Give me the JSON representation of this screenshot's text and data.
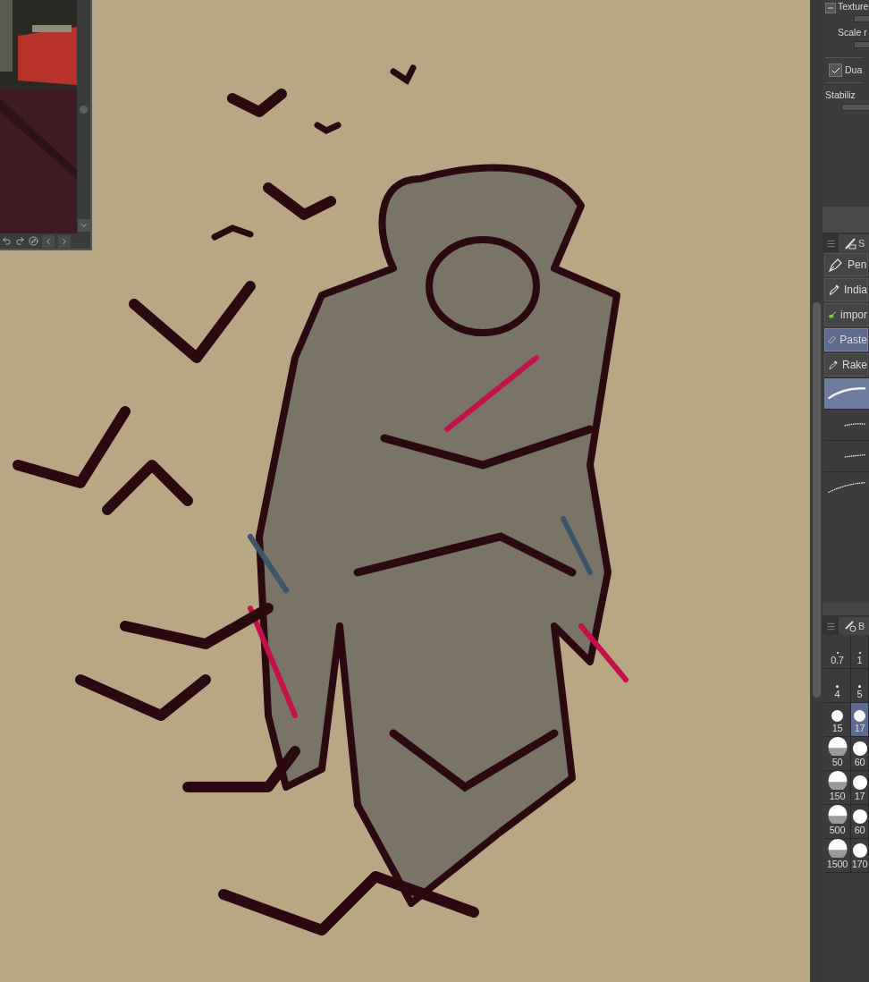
{
  "tool_property": {
    "group": {
      "expanded": true,
      "items": [
        {
          "label": "Texture"
        },
        {
          "label": "Scale r"
        }
      ]
    },
    "checkbox": {
      "label": "Dua",
      "checked": true
    },
    "stabilization": {
      "label": "Stabiliz"
    }
  },
  "sub_tool_panel": {
    "tab": "S",
    "items": [
      {
        "name": "Pen",
        "selected": false
      },
      {
        "name": "India",
        "selected": false
      },
      {
        "name": "impor",
        "selected": false
      },
      {
        "name": "Paste",
        "selected": true
      },
      {
        "name": "Rake",
        "selected": false
      }
    ],
    "previews": [
      {
        "selected": true
      },
      {
        "selected": false
      },
      {
        "selected": false
      },
      {
        "selected": false
      }
    ]
  },
  "brush_size_panel": {
    "tab": "B",
    "sizes": [
      {
        "label": "0.7",
        "selected": false
      },
      {
        "label": "1",
        "selected": false
      },
      {
        "label": "4",
        "selected": false
      },
      {
        "label": "5",
        "selected": false
      },
      {
        "label": "15",
        "selected": false
      },
      {
        "label": "17",
        "selected": true
      },
      {
        "label": "50",
        "selected": false
      },
      {
        "label": "60",
        "selected": false
      },
      {
        "label": "150",
        "selected": false
      },
      {
        "label": "17",
        "selected": false
      },
      {
        "label": "500",
        "selected": false
      },
      {
        "label": "60",
        "selected": false
      },
      {
        "label": "1500",
        "selected": false
      },
      {
        "label": "170",
        "selected": false
      }
    ]
  }
}
